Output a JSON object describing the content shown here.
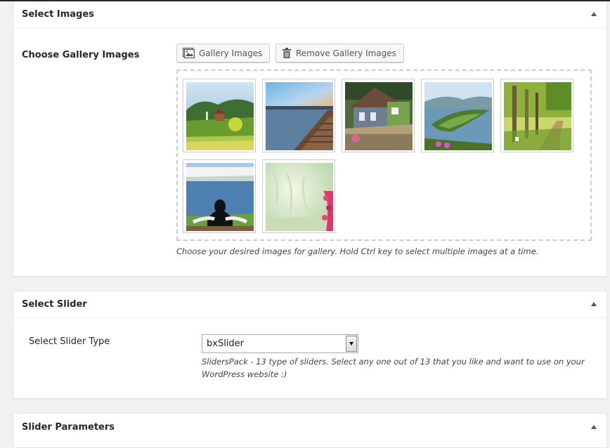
{
  "panels": {
    "select_images": {
      "title": "Select Images",
      "row_label": "Choose Gallery Images",
      "gallery_button": "Gallery Images",
      "remove_button": "Remove Gallery Images",
      "hint": "Choose your desired images for gallery. Hold Ctrl key to select multiple images at a time.",
      "thumbnails": [
        "village-lake-image",
        "pier-sunset-image",
        "cottage-image",
        "river-hills-image",
        "forest-path-image",
        "cliffs-sea-image",
        "misty-forest-image"
      ]
    },
    "select_slider": {
      "title": "Select Slider",
      "row_label": "Select Slider Type",
      "selected_value": "bxSlider",
      "hint_line1": "SlidersPack - 13 type of sliders. Select any one out of 13 that you like and want to use on your",
      "hint_line2": "WordPress website :)"
    },
    "slider_parameters": {
      "title": "Slider Parameters"
    }
  },
  "colors": {
    "background": "#f1f1f1",
    "panel": "#ffffff",
    "text": "#23282d"
  }
}
